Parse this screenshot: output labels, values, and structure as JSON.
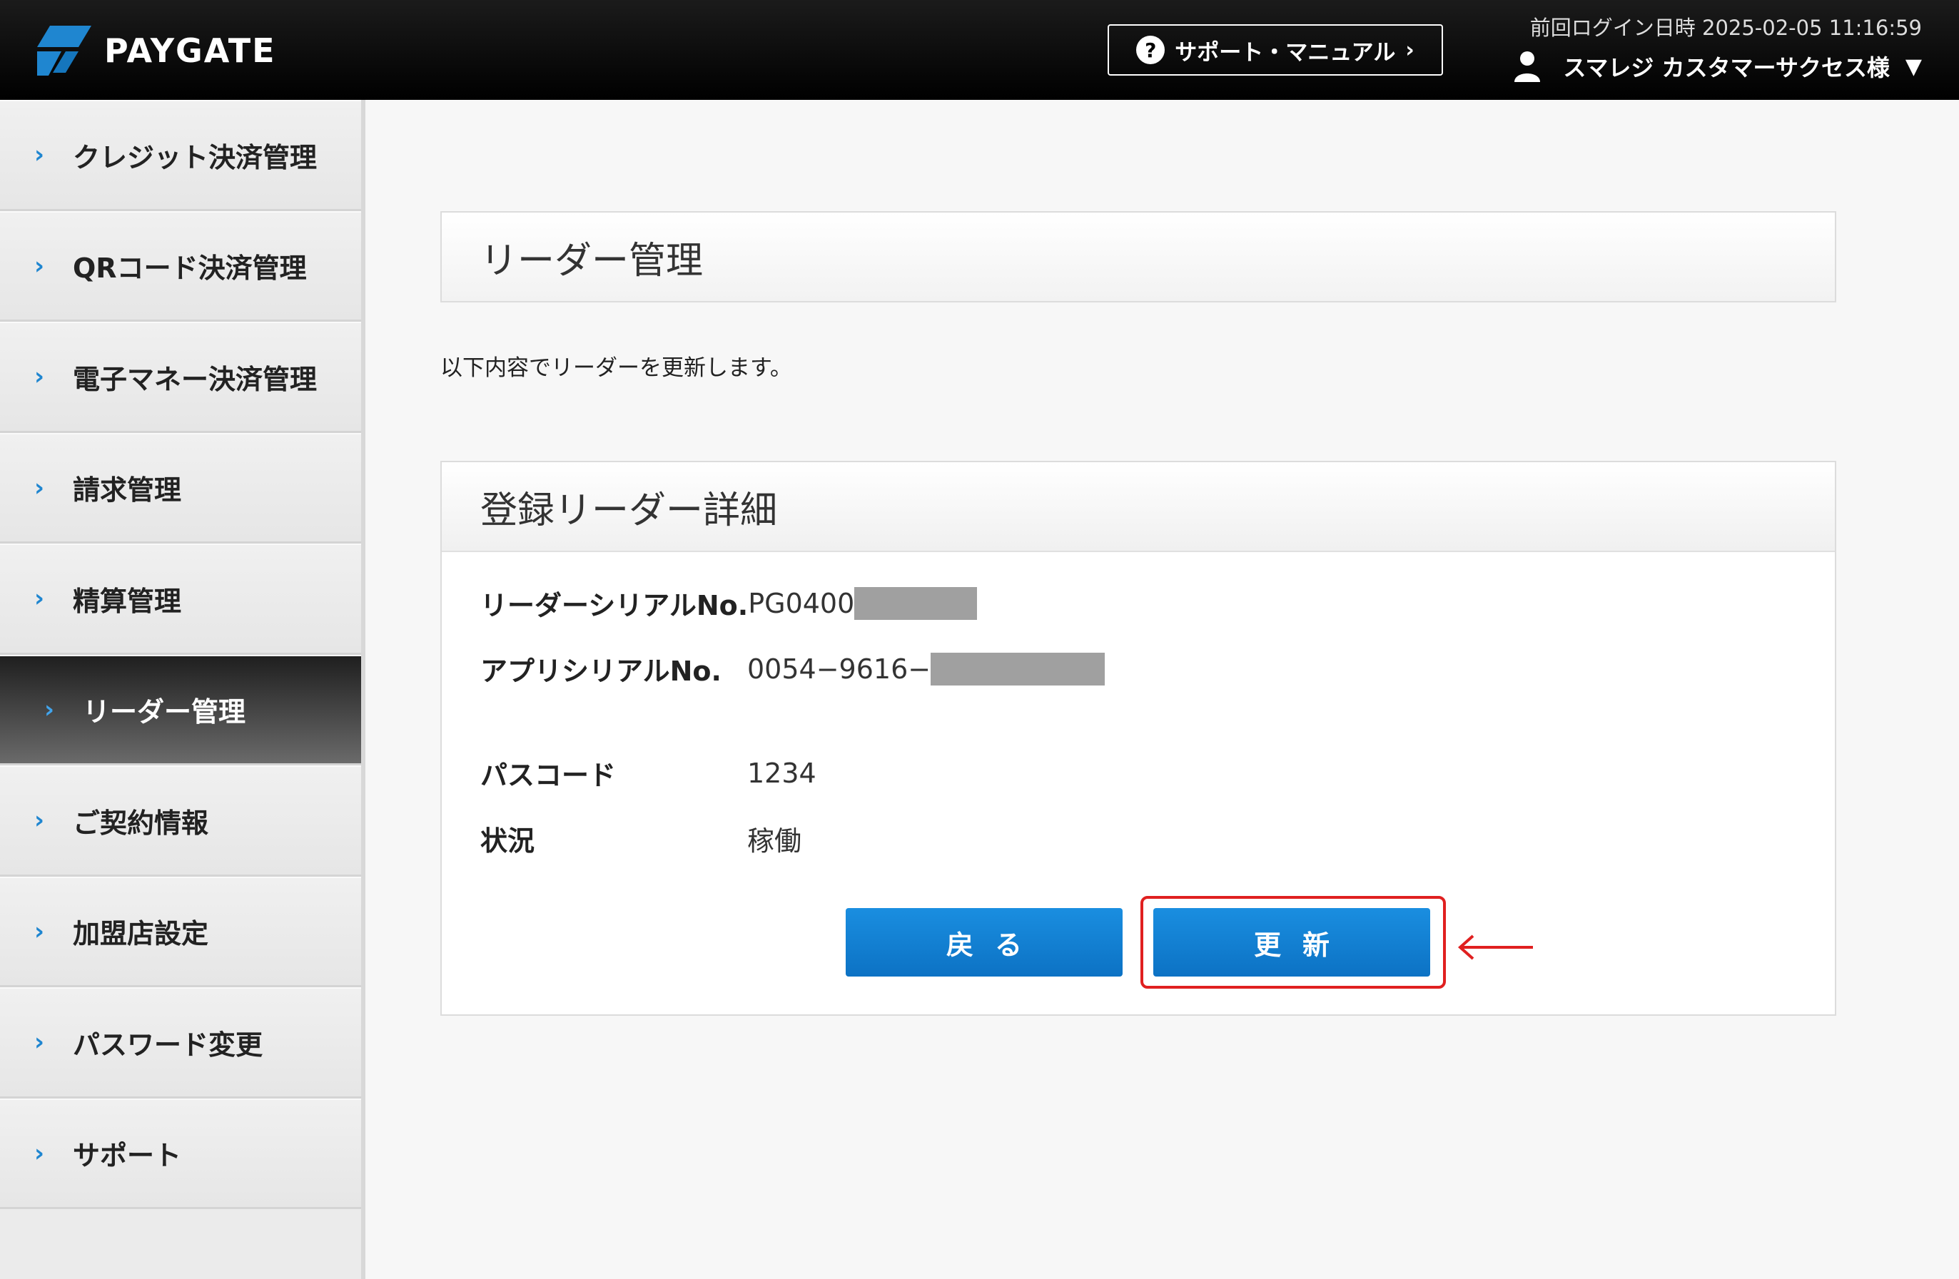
{
  "header": {
    "logo_text": "PAYGATE",
    "support_label": "サポート・マニュアル",
    "last_login": "前回ログイン日時 2025-02-05 11:16:59",
    "user_name": "スマレジ カスタマーサクセス様"
  },
  "sidebar": {
    "items": [
      {
        "label": "クレジット決済管理"
      },
      {
        "label": "QRコード決済管理"
      },
      {
        "label": "電子マネー決済管理"
      },
      {
        "label": "請求管理"
      },
      {
        "label": "精算管理"
      },
      {
        "label": "リーダー管理",
        "active": true
      },
      {
        "label": "ご契約情報"
      },
      {
        "label": "加盟店設定"
      },
      {
        "label": "パスワード変更"
      },
      {
        "label": "サポート"
      }
    ]
  },
  "main": {
    "page_title": "リーダー管理",
    "intro": "以下内容でリーダーを更新します。",
    "detail_title": "登録リーダー詳細",
    "fields": {
      "reader_serial": {
        "label": "リーダーシリアルNo.",
        "value": "PG0400"
      },
      "app_serial": {
        "label": "アプリシリアルNo.",
        "value": "0054−9616−"
      },
      "passcode": {
        "label": "パスコード",
        "value": "1234"
      },
      "status": {
        "label": "状況",
        "value": "稼働"
      }
    },
    "buttons": {
      "back": "戻る",
      "update": "更新"
    }
  },
  "colors": {
    "accent": "#1f86d0",
    "button": "#0c72c4",
    "highlight": "#e02020"
  }
}
